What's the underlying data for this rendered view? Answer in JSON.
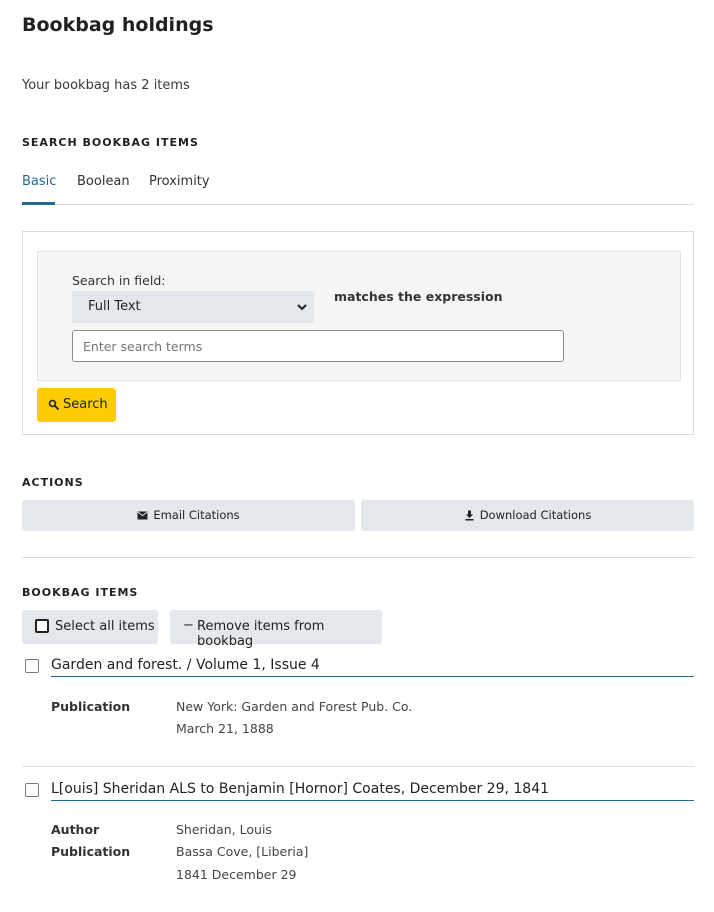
{
  "page": {
    "title": "Bookbag holdings",
    "count_text": "Your bookbag has 2 items"
  },
  "search": {
    "heading": "SEARCH BOOKBAG ITEMS",
    "tabs": [
      "Basic",
      "Boolean",
      "Proximity"
    ],
    "field_label": "Search in field:",
    "field_value": "Full Text",
    "matches_label": "matches the expression",
    "input_placeholder": "Enter search terms",
    "input_value": "",
    "button_label": "Search"
  },
  "actions": {
    "heading": "ACTIONS",
    "email_label": "Email Citations",
    "download_label": "Download Citations"
  },
  "bookbag": {
    "heading": "BOOKBAG ITEMS",
    "select_all_label": "Select all items",
    "remove_label": "Remove items from bookbag",
    "remove_symbol": "−",
    "items": [
      {
        "title": "Garden and forest. / Volume 1, Issue 4",
        "fields": [
          {
            "label": "Publication",
            "values": [
              "New York: Garden and Forest Pub. Co.",
              "March 21, 1888"
            ]
          }
        ]
      },
      {
        "title": "L[ouis] Sheridan ALS to Benjamin [Hornor] Coates, December 29, 1841",
        "fields": [
          {
            "label": "Author",
            "values": [
              "Sheridan, Louis"
            ]
          },
          {
            "label": "Publication",
            "values": [
              "Bassa Cove, [Liberia]",
              "1841 December 29"
            ]
          }
        ]
      }
    ]
  },
  "colors": {
    "accent": "#246a88",
    "button_yellow": "#ffcb05",
    "button_gray": "#e4e7eb"
  },
  "icons": {
    "search_button": "search-icon",
    "email": "envelope-icon",
    "download": "download-icon",
    "select": "chevron-down-icon"
  }
}
